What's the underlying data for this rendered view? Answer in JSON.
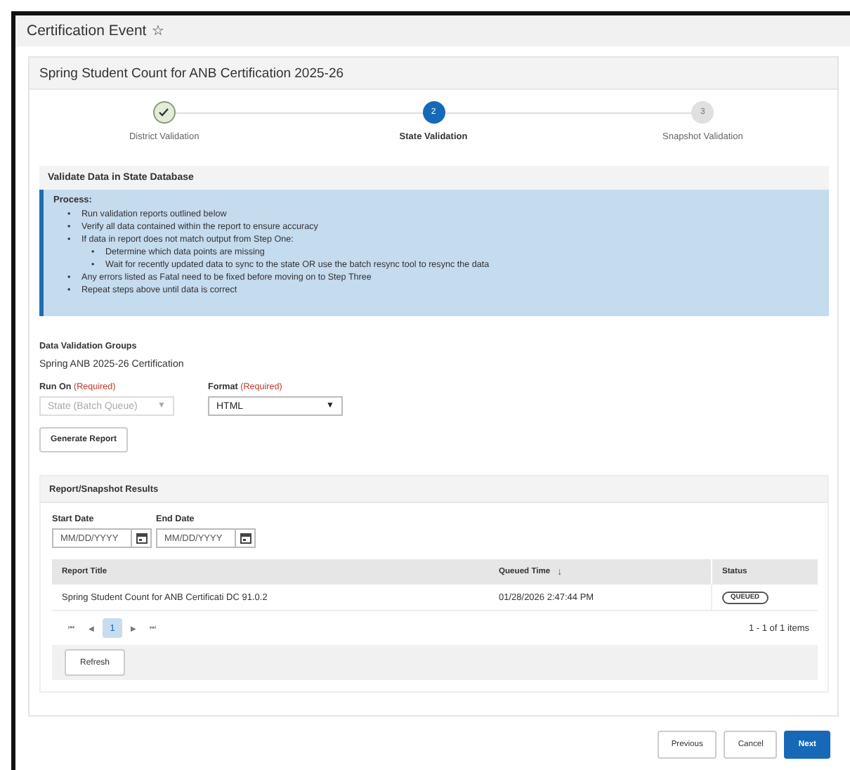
{
  "page": {
    "title": "Certification Event",
    "favorite_icon": "☆"
  },
  "card": {
    "title": "Spring Student Count for ANB Certification 2025-26"
  },
  "steps": [
    {
      "label": "District Validation",
      "kind": "done"
    },
    {
      "label": "State Validation",
      "number": "2",
      "kind": "current"
    },
    {
      "label": "Snapshot Validation",
      "number": "3",
      "kind": "pending"
    }
  ],
  "validate": {
    "title": "Validate Data in State Database",
    "process_title": "Process:",
    "items": [
      {
        "bullet": "•",
        "text": "Run validation reports outlined below"
      },
      {
        "bullet": "•",
        "text": "Verify all data contained within the report to ensure accuracy"
      },
      {
        "bullet": "•",
        "text": "If data in report does not match output from Step One:",
        "children": [
          {
            "bullet": "•",
            "text": "Determine which data points are missing"
          },
          {
            "bullet": "•",
            "text": "Wait for recently updated data to sync to the state OR use the batch resync tool to resync the data"
          }
        ]
      },
      {
        "bullet": "•",
        "text": "Any errors listed as Fatal need to be fixed before moving on to Step Three"
      },
      {
        "bullet": "•",
        "text": "Repeat steps above until data is correct"
      }
    ],
    "groups_label": "Data Validation Groups",
    "groups_value": "Spring ANB 2025-26 Certification",
    "fields": [
      {
        "label": "Run On",
        "required": "(Required)",
        "value": "State (Batch Queue)",
        "caret": "▼",
        "disabled": true
      },
      {
        "label": "Format",
        "required": "(Required)",
        "value": "HTML",
        "caret": "▼",
        "disabled": false
      }
    ],
    "generate_button": "Generate Report"
  },
  "results": {
    "title": "Report/Snapshot Results",
    "dates": [
      {
        "label": "Start Date",
        "placeholder": "MM/DD/YYYY"
      },
      {
        "label": "End Date",
        "placeholder": "MM/DD/YYYY"
      }
    ],
    "columns": [
      {
        "label": "Report Title"
      },
      {
        "label": "Queued Time",
        "sort": "↓"
      },
      {
        "label": "Status"
      }
    ],
    "rows": [
      {
        "title": "Spring Student Count for ANB Certificati DC 91.0.2",
        "time": "01/28/2026 2:47:44 PM",
        "status": "QUEUED"
      }
    ],
    "pager": {
      "first": "⏮",
      "prev": "◀",
      "pages": [
        {
          "label": "1",
          "selected": true
        }
      ],
      "next": "▶",
      "last": "⏭",
      "summary": "1 - 1 of 1 items"
    },
    "refresh_button": "Refresh"
  },
  "footer_buttons": [
    {
      "label": "Previous",
      "primary": false
    },
    {
      "label": "Cancel",
      "primary": false
    },
    {
      "label": "Next",
      "primary": true
    }
  ]
}
